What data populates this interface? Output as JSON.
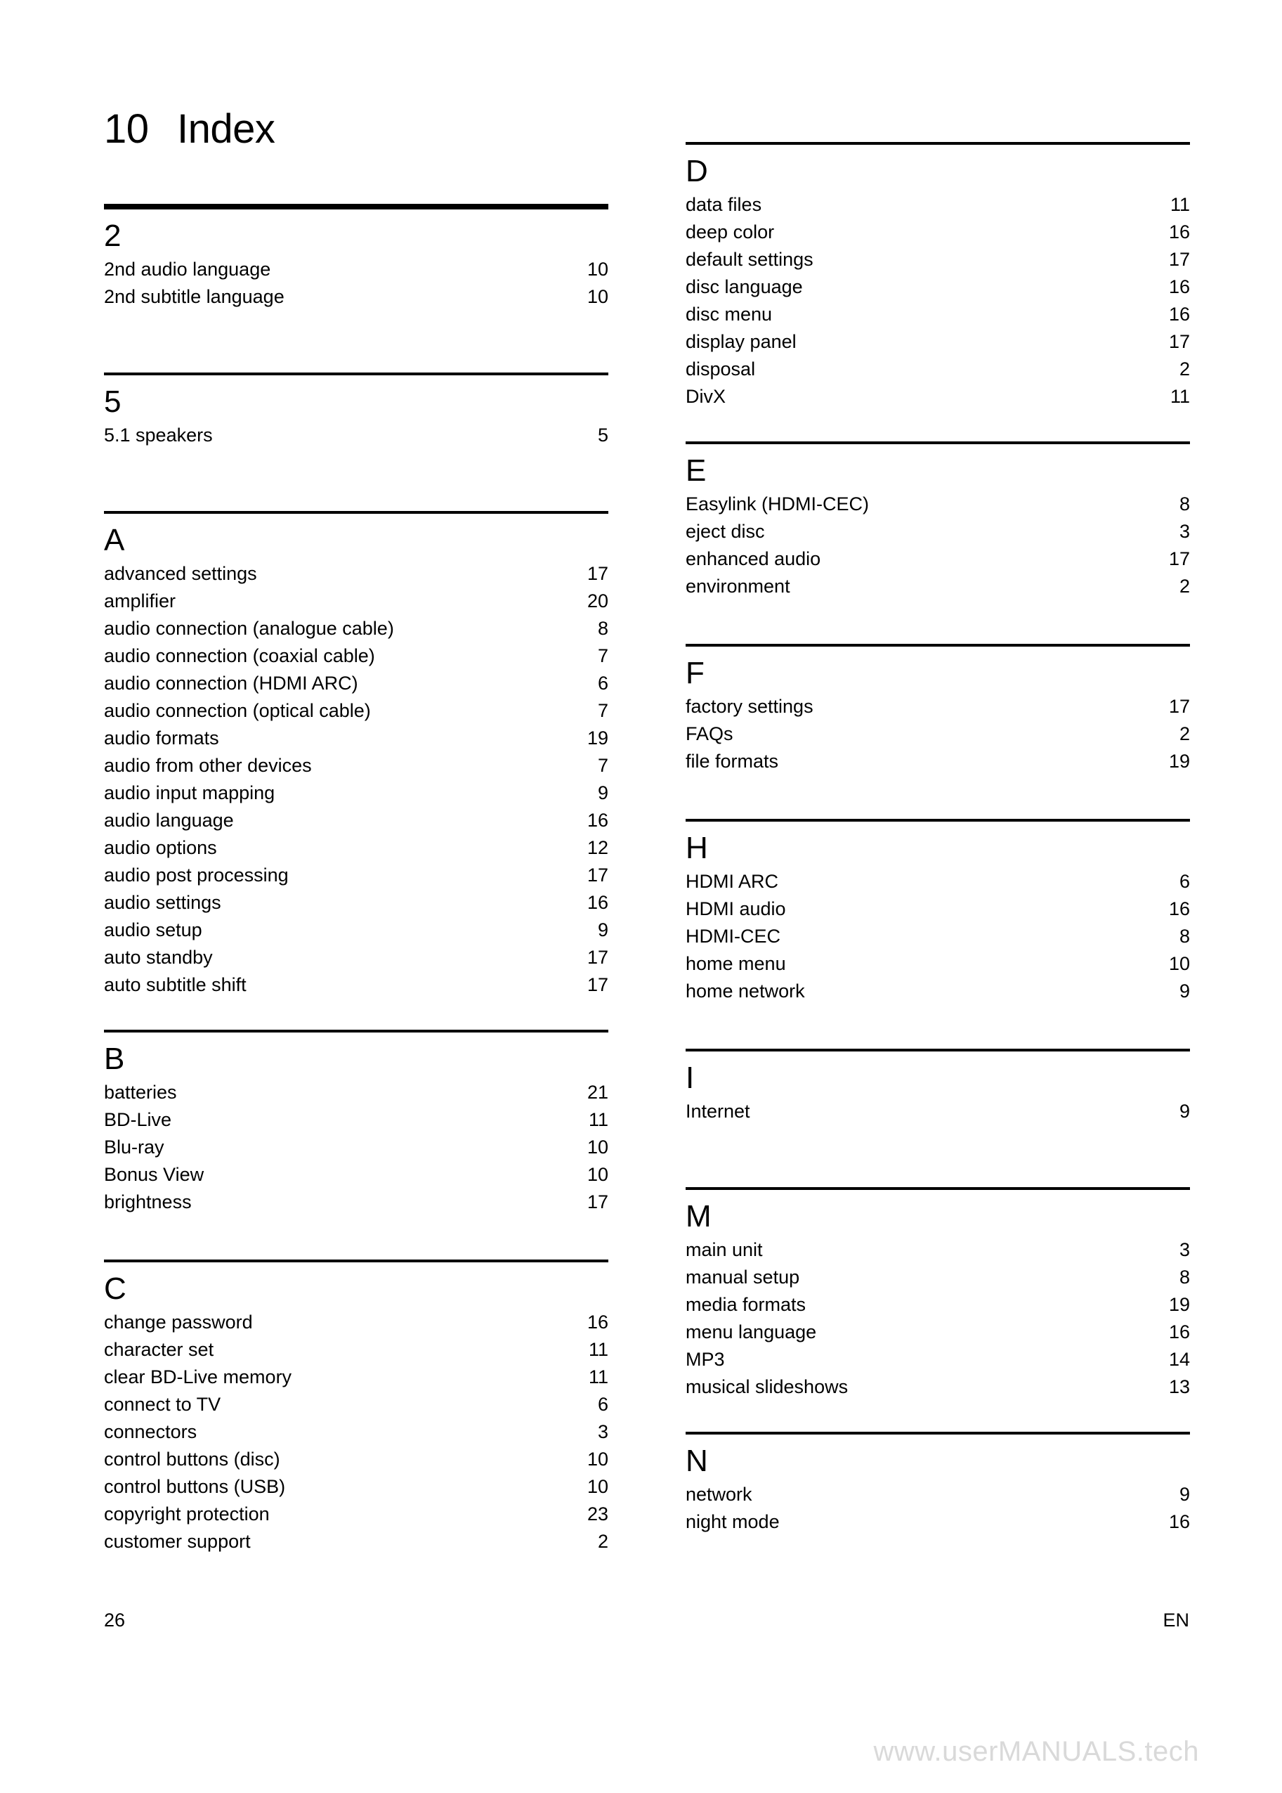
{
  "chapter": {
    "number": "10",
    "title": "Index"
  },
  "footer": {
    "page_number": "26",
    "language_code": "EN"
  },
  "watermark": {
    "text": "www.userMANUALS.tech"
  },
  "columns": [
    {
      "sections": [
        {
          "letter": "2",
          "rule": "thick",
          "entries": [
            {
              "label": "2nd audio language",
              "page": "10"
            },
            {
              "label": "2nd subtitle language",
              "page": "10"
            }
          ]
        },
        {
          "letter": "5",
          "rule": "thin",
          "entries": [
            {
              "label": "5.1 speakers",
              "page": "5"
            }
          ]
        },
        {
          "letter": "A",
          "rule": "thin",
          "entries": [
            {
              "label": "advanced settings",
              "page": "17"
            },
            {
              "label": "amplifier",
              "page": "20"
            },
            {
              "label": "audio connection (analogue cable)",
              "page": "8"
            },
            {
              "label": "audio connection (coaxial cable)",
              "page": "7"
            },
            {
              "label": "audio connection (HDMI ARC)",
              "page": "6"
            },
            {
              "label": "audio connection (optical cable)",
              "page": "7"
            },
            {
              "label": "audio formats",
              "page": "19"
            },
            {
              "label": "audio from other devices",
              "page": "7"
            },
            {
              "label": "audio input mapping",
              "page": "9"
            },
            {
              "label": "audio language",
              "page": "16"
            },
            {
              "label": "audio options",
              "page": "12"
            },
            {
              "label": "audio post processing",
              "page": "17"
            },
            {
              "label": "audio settings",
              "page": "16"
            },
            {
              "label": "audio setup",
              "page": "9"
            },
            {
              "label": "auto standby",
              "page": "17"
            },
            {
              "label": "auto subtitle shift",
              "page": "17"
            }
          ]
        },
        {
          "letter": "B",
          "rule": "thin",
          "entries": [
            {
              "label": "batteries",
              "page": "21"
            },
            {
              "label": "BD-Live",
              "page": "11"
            },
            {
              "label": "Blu-ray",
              "page": "10"
            },
            {
              "label": "Bonus View",
              "page": "10"
            },
            {
              "label": "brightness",
              "page": "17"
            }
          ]
        },
        {
          "letter": "C",
          "rule": "thin",
          "entries": [
            {
              "label": "change password",
              "page": "16"
            },
            {
              "label": "character set",
              "page": "11"
            },
            {
              "label": "clear BD-Live memory",
              "page": "11"
            },
            {
              "label": "connect to TV",
              "page": "6"
            },
            {
              "label": "connectors",
              "page": "3"
            },
            {
              "label": "control buttons (disc)",
              "page": "10"
            },
            {
              "label": "control buttons (USB)",
              "page": "10"
            },
            {
              "label": "copyright protection",
              "page": "23"
            },
            {
              "label": "customer support",
              "page": "2"
            }
          ]
        }
      ]
    },
    {
      "sections": [
        {
          "letter": "D",
          "rule": "thin",
          "entries": [
            {
              "label": "data files",
              "page": "11"
            },
            {
              "label": "deep color",
              "page": "16"
            },
            {
              "label": "default settings",
              "page": "17"
            },
            {
              "label": "disc language",
              "page": "16"
            },
            {
              "label": "disc menu",
              "page": "16"
            },
            {
              "label": "display panel",
              "page": "17"
            },
            {
              "label": "disposal",
              "page": "2"
            },
            {
              "label": "DivX",
              "page": "11"
            }
          ]
        },
        {
          "letter": "E",
          "rule": "thin",
          "entries": [
            {
              "label": "Easylink (HDMI-CEC)",
              "page": "8"
            },
            {
              "label": "eject disc",
              "page": "3"
            },
            {
              "label": "enhanced audio",
              "page": "17"
            },
            {
              "label": "environment",
              "page": "2"
            }
          ]
        },
        {
          "letter": "F",
          "rule": "thin",
          "entries": [
            {
              "label": "factory settings",
              "page": "17"
            },
            {
              "label": "FAQs",
              "page": "2"
            },
            {
              "label": "file formats",
              "page": "19"
            }
          ]
        },
        {
          "letter": "H",
          "rule": "thin",
          "entries": [
            {
              "label": "HDMI ARC",
              "page": "6"
            },
            {
              "label": "HDMI audio",
              "page": "16"
            },
            {
              "label": "HDMI-CEC",
              "page": "8"
            },
            {
              "label": "home menu",
              "page": "10"
            },
            {
              "label": "home network",
              "page": "9"
            }
          ]
        },
        {
          "letter": "I",
          "rule": "thin",
          "entries": [
            {
              "label": "Internet",
              "page": "9"
            }
          ]
        },
        {
          "letter": "M",
          "rule": "thin",
          "entries": [
            {
              "label": "main unit",
              "page": "3"
            },
            {
              "label": "manual setup",
              "page": "8"
            },
            {
              "label": "media formats",
              "page": "19"
            },
            {
              "label": "menu language",
              "page": "16"
            },
            {
              "label": "MP3",
              "page": "14"
            },
            {
              "label": "musical slideshows",
              "page": "13"
            }
          ]
        },
        {
          "letter": "N",
          "rule": "thin",
          "entries": [
            {
              "label": "network",
              "page": "9"
            },
            {
              "label": "night mode",
              "page": "16"
            }
          ]
        }
      ]
    }
  ]
}
